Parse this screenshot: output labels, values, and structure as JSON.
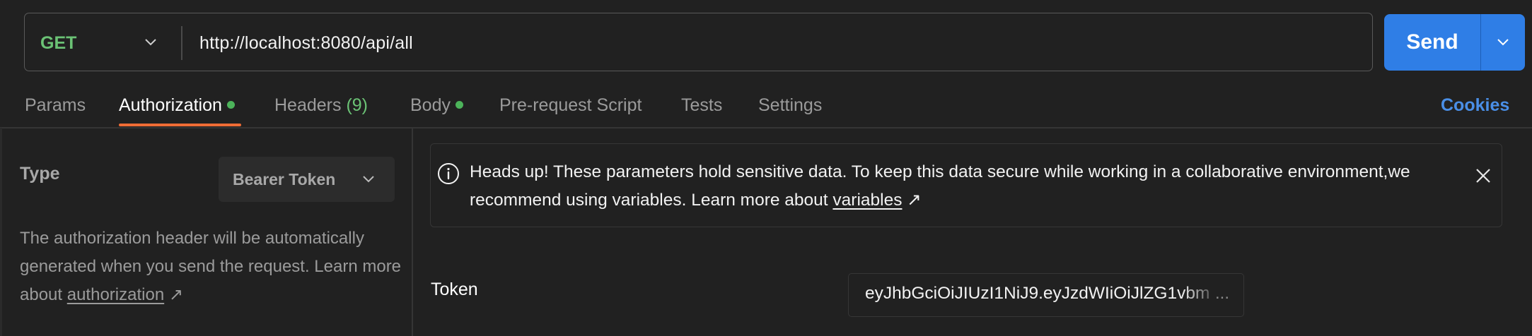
{
  "request": {
    "method": "GET",
    "url": "http://localhost:8080/api/all",
    "send_label": "Send"
  },
  "tabs": [
    {
      "label": "Params"
    },
    {
      "label": "Authorization",
      "active": true,
      "indicator": true
    },
    {
      "label": "Headers",
      "count": "(9)"
    },
    {
      "label": "Body",
      "indicator": true
    },
    {
      "label": "Pre-request Script"
    },
    {
      "label": "Tests"
    },
    {
      "label": "Settings"
    }
  ],
  "cookies_label": "Cookies",
  "auth": {
    "type_label": "Type",
    "selected_type": "Bearer Token",
    "description_prefix": "The authorization header will be automatically generated when you send the request. Learn more about ",
    "description_link": "authorization",
    "link_arrow": "↗"
  },
  "banner": {
    "text_prefix": "Heads up! These parameters hold sensitive data. To keep this data secure while working in a collaborative environment,we recommend using variables. Learn more about ",
    "link": "variables",
    "link_arrow": "↗"
  },
  "token": {
    "label": "Token",
    "value": "eyJhbGciOiJIUzI1NiJ9.eyJzdWIiOiJlZG1vbm",
    "ellipsis": "..."
  },
  "colors": {
    "accent_blue": "#2f7ee6",
    "method_green": "#6bc275",
    "tab_underline": "#ef6c35",
    "indicator_green": "#4cb35a",
    "link_blue": "#4a8fe7"
  },
  "icons": [
    "chevron-down-icon",
    "info-icon",
    "close-icon",
    "external-link-arrow-icon"
  ]
}
